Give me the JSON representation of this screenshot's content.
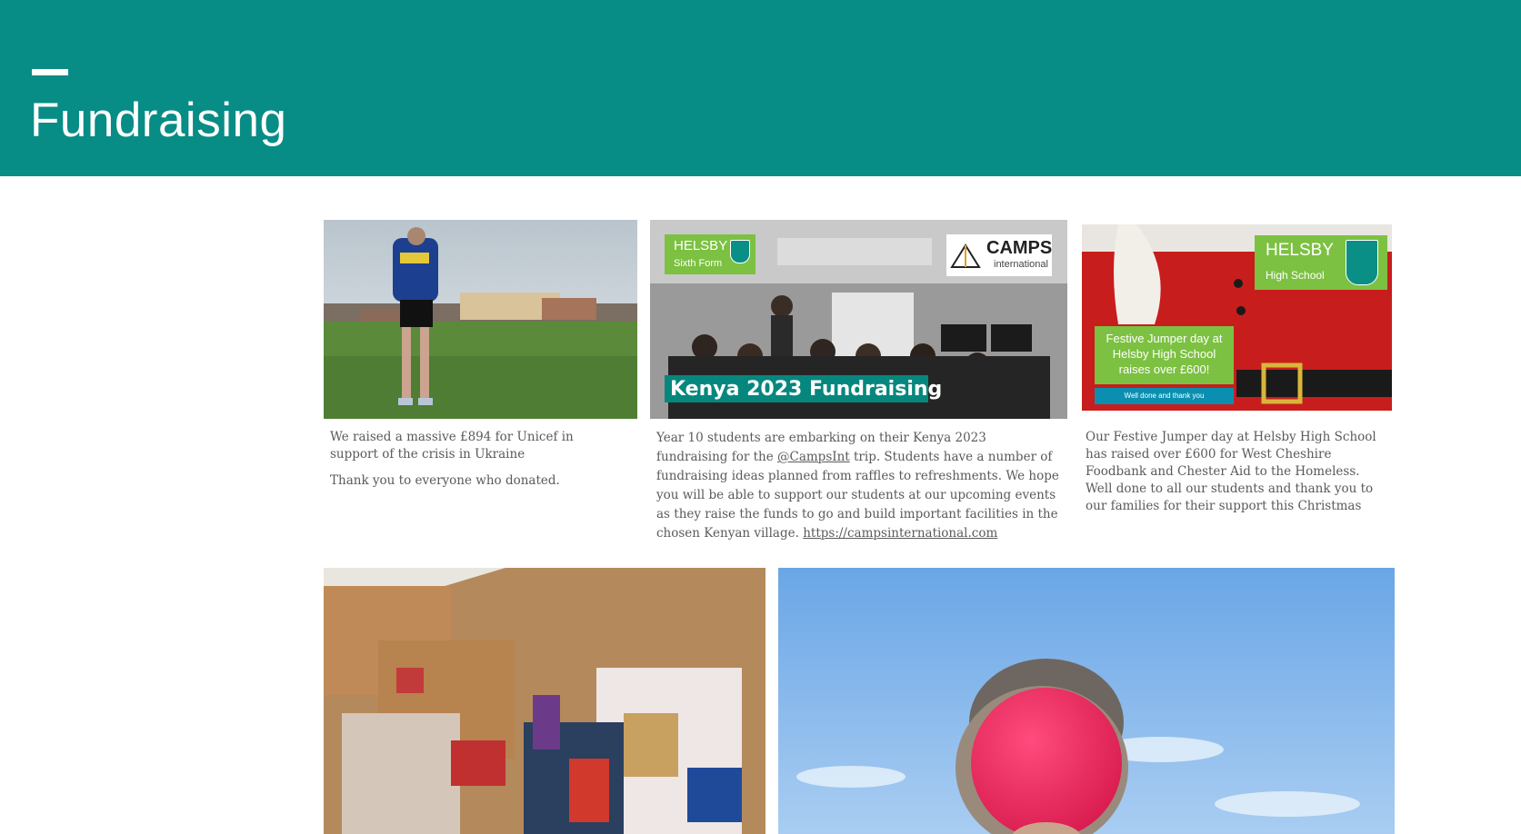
{
  "page": {
    "title": "Fundraising"
  },
  "cards": [
    {
      "caption_lines": [
        "We raised a massive £894 for Unicef in support of the crisis in Ukraine",
        "Thank you to everyone who donated."
      ]
    },
    {
      "badge_school": "HELSBY",
      "badge_sub": "Sixth Form",
      "partner_logo_main": "CAMPS",
      "partner_logo_sub": "international",
      "banner_text": "Kenya 2023 Fundraising",
      "caption_pre": "Year 10 students are embarking on their Kenya 2023 fundraising for the ",
      "caption_link1": "@CampsInt",
      "caption_mid": " trip.  Students have a number of fundraising ideas planned from raffles to refreshments. We hope you will be able to support our students at our upcoming events as they raise the funds to go and build important facilities in the chosen Kenyan village.  ",
      "caption_link2": "https://campsinternational.com"
    },
    {
      "badge_school": "HELSBY",
      "badge_sub": "High School",
      "poster_text": "Festive Jumper day at Helsby High School raises over £600!",
      "poster_sub": "Well done and thank you",
      "caption": "Our Festive Jumper day at Helsby High School has raised over £600 for West Cheshire Foodbank and Chester Aid to the Homeless. Well done to all our students and thank you to our families for their support this Christmas"
    }
  ],
  "colors": {
    "header": "#088c86",
    "accent_green": "#7cc142",
    "teal": "#0a8f86"
  }
}
